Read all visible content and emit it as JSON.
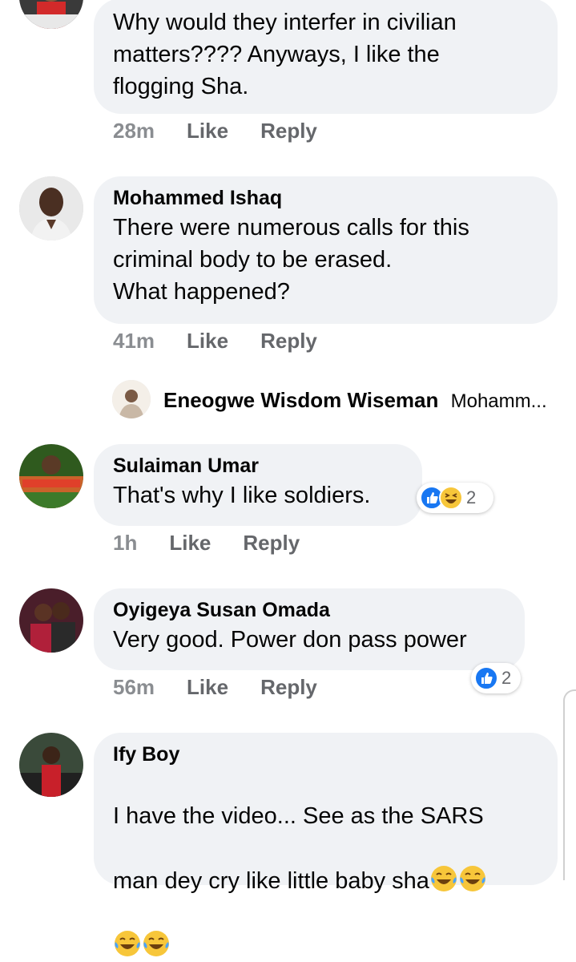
{
  "comments": [
    {
      "author": "",
      "text": "Why would they interfer in civilian\nmatters???? Anyways, I like the\nflogging Sha.",
      "time": "28m",
      "like": "Like",
      "reply": "Reply"
    },
    {
      "author": "Mohammed Ishaq",
      "text": "There were numerous calls for this\ncriminal body to be erased.\nWhat happened?",
      "time": "41m",
      "like": "Like",
      "reply": "Reply"
    },
    {
      "author": "Sulaiman Umar",
      "text": "That's why I like soldiers.",
      "time": "1h",
      "like": "Like",
      "reply": "Reply",
      "reactions": {
        "icons": [
          "like-icon",
          "laugh-icon"
        ],
        "count": "2"
      }
    },
    {
      "author": "Oyigeya Susan Omada",
      "text": "Very good. Power don pass power",
      "time": "56m",
      "like": "Like",
      "reply": "Reply",
      "reactions": {
        "icons": [
          "like-icon"
        ],
        "count": "2"
      }
    },
    {
      "author": "Ify Boy",
      "text_line1": "I have the video... See as the SARS",
      "text_line2": "man dey cry like little baby sha",
      "emoji_name": "laughing-tears-emoji"
    }
  ],
  "reply_preview": {
    "author": "Eneogwe Wisdom Wiseman",
    "preview": "Mohamm..."
  },
  "colors": {
    "bubble": "#f0f2f5",
    "meta_text": "#65676b",
    "like_blue": "#1877f2"
  }
}
